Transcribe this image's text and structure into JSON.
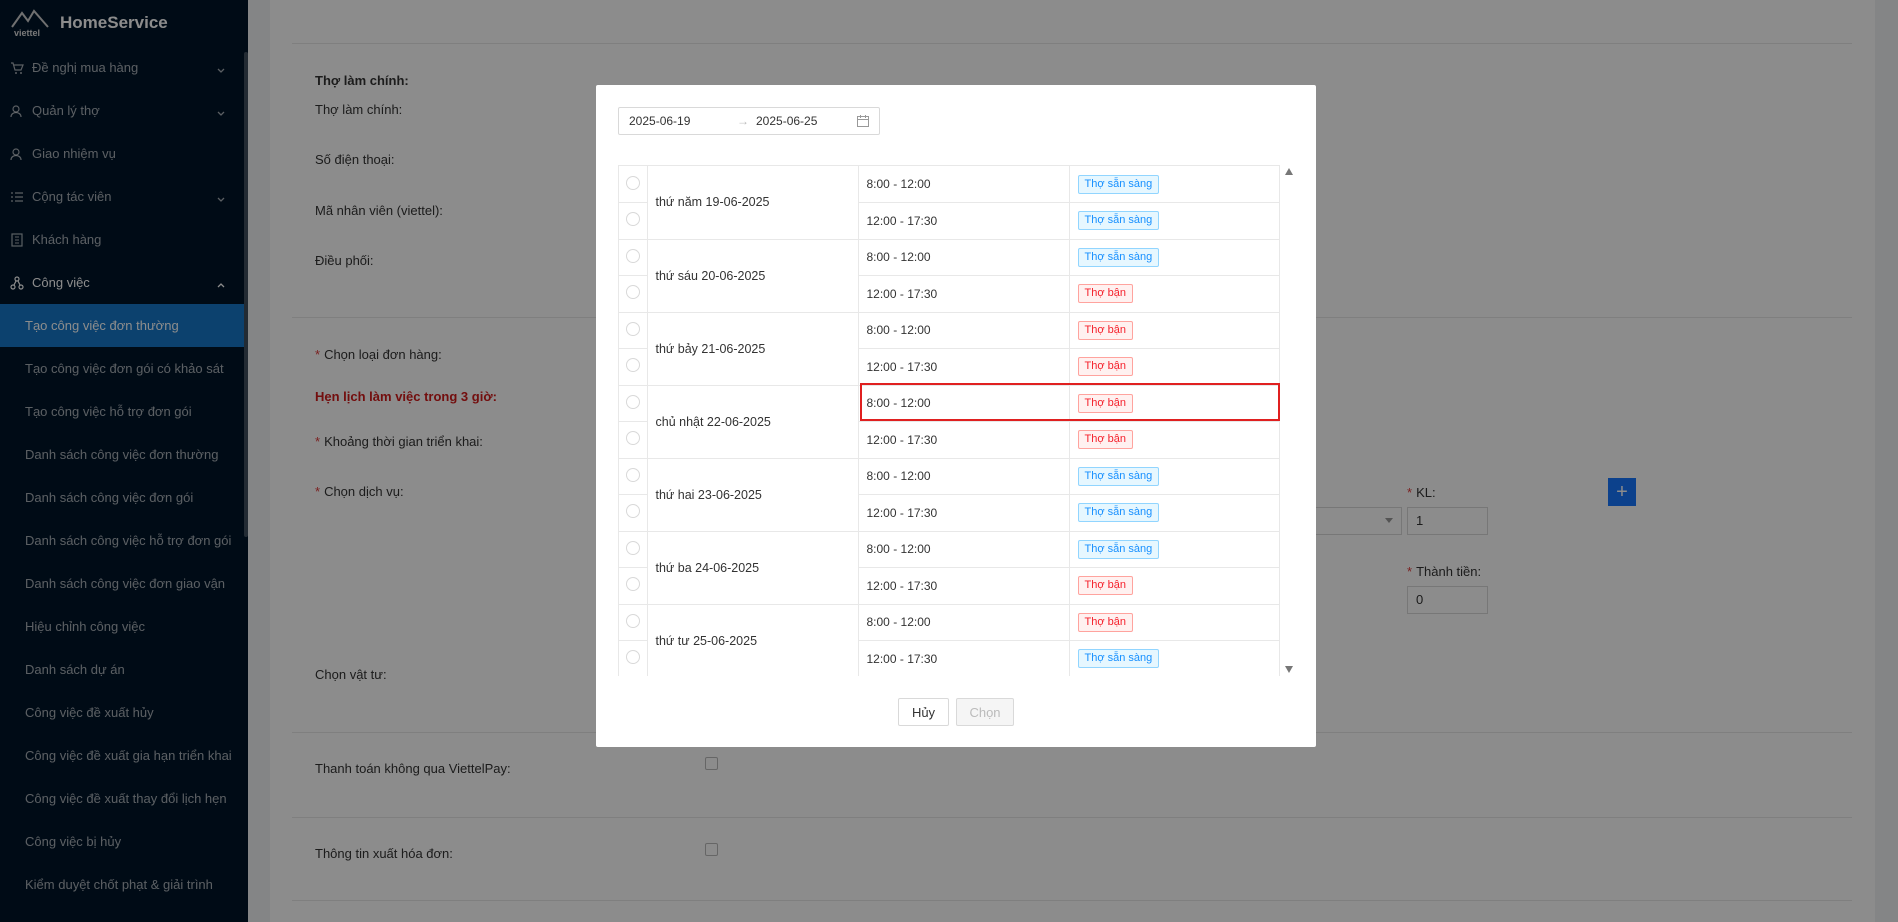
{
  "app": {
    "name": "HomeService",
    "logo_text": "viettel"
  },
  "sidebar": {
    "items": [
      {
        "label": "Đề nghị mua hàng",
        "icon": "cart-icon",
        "expandable": true
      },
      {
        "label": "Quản lý thợ",
        "icon": "users-icon",
        "expandable": true
      },
      {
        "label": "Giao nhiệm vụ",
        "icon": "user-task-icon",
        "expandable": false
      },
      {
        "label": "Cộng tác viên",
        "icon": "list-icon",
        "expandable": true
      },
      {
        "label": "Khách hàng",
        "icon": "building-icon",
        "expandable": false
      },
      {
        "label": "Công việc",
        "icon": "cluster-icon",
        "expandable": true,
        "expanded": true
      }
    ],
    "subitems": [
      "Tạo công việc đơn thường",
      "Tạo công việc đơn gói có khảo sát",
      "Tạo công việc hỗ trợ đơn gói",
      "Danh sách công việc đơn thường",
      "Danh sách công việc đơn gói",
      "Danh sách công việc hỗ trợ đơn gói",
      "Danh sách công việc đơn giao vận",
      "Hiệu chỉnh công việc",
      "Danh sách dự án",
      "Công việc đề xuất hủy",
      "Công việc đề xuất gia hạn triển khai",
      "Công việc đề xuất thay đổi lịch hẹn",
      "Công việc bị hủy",
      "Kiểm duyệt chốt phạt & giải trình"
    ],
    "active_subitem": 0
  },
  "form": {
    "section_title": "Thợ làm chính:",
    "labels": {
      "tho_lam_chinh": "Thợ làm chính:",
      "so_dien_thoai": "Số điện thoại:",
      "ma_nhan_vien": "Mã nhân viên (viettel):",
      "dieu_phoi": "Điều phối:",
      "chon_loai_don": "Chọn loại đơn hàng:",
      "hen_lich": "Hẹn lịch làm việc trong 3 giờ:",
      "khoang_thoi_gian": "Khoảng thời gian triển khai:",
      "chon_dich_vu": "Chọn dịch vụ:",
      "chon_vat_tu": "Chọn vật tư:",
      "thanh_toan": "Thanh toán không qua ViettelPay:",
      "thong_tin_hoa_don": "Thông tin xuất hóa đơn:",
      "kl": "KL:",
      "thanh_tien": "Thành tiền:"
    },
    "kl_value": "1",
    "thanh_tien_value": "0",
    "required_mark": "*",
    "plus_label": "+"
  },
  "modal": {
    "date_from": "2025-06-19",
    "date_sep": "→",
    "date_to": "2025-06-25",
    "days": [
      {
        "day": "thứ năm 19-06-2025",
        "slots": [
          {
            "time": "8:00 - 12:00",
            "status": "Thợ sẵn sàng",
            "kind": "ready"
          },
          {
            "time": "12:00 - 17:30",
            "status": "Thợ sẵn sàng",
            "kind": "ready"
          }
        ]
      },
      {
        "day": "thứ sáu 20-06-2025",
        "slots": [
          {
            "time": "8:00 - 12:00",
            "status": "Thợ sẵn sàng",
            "kind": "ready"
          },
          {
            "time": "12:00 - 17:30",
            "status": "Thợ bận",
            "kind": "busy"
          }
        ]
      },
      {
        "day": "thứ bảy 21-06-2025",
        "slots": [
          {
            "time": "8:00 - 12:00",
            "status": "Thợ bận",
            "kind": "busy"
          },
          {
            "time": "12:00 - 17:30",
            "status": "Thợ bận",
            "kind": "busy"
          }
        ]
      },
      {
        "day": "chủ nhật 22-06-2025",
        "slots": [
          {
            "time": "8:00 - 12:00",
            "status": "Thợ bận",
            "kind": "busy"
          },
          {
            "time": "12:00 - 17:30",
            "status": "Thợ bận",
            "kind": "busy"
          }
        ]
      },
      {
        "day": "thứ hai 23-06-2025",
        "slots": [
          {
            "time": "8:00 - 12:00",
            "status": "Thợ sẵn sàng",
            "kind": "ready"
          },
          {
            "time": "12:00 - 17:30",
            "status": "Thợ sẵn sàng",
            "kind": "ready"
          }
        ]
      },
      {
        "day": "thứ ba 24-06-2025",
        "slots": [
          {
            "time": "8:00 - 12:00",
            "status": "Thợ sẵn sàng",
            "kind": "ready"
          },
          {
            "time": "12:00 - 17:30",
            "status": "Thợ bận",
            "kind": "busy"
          }
        ]
      },
      {
        "day": "thứ tư 25-06-2025",
        "slots": [
          {
            "time": "8:00 - 12:00",
            "status": "Thợ bận",
            "kind": "busy"
          },
          {
            "time": "12:00 - 17:30",
            "status": "Thợ sẵn sàng",
            "kind": "ready"
          }
        ]
      }
    ],
    "cancel_label": "Hủy",
    "ok_label": "Chọn",
    "colors": {
      "highlight": "#e02020",
      "ready": "#1890ff",
      "busy": "#f5222d"
    }
  }
}
